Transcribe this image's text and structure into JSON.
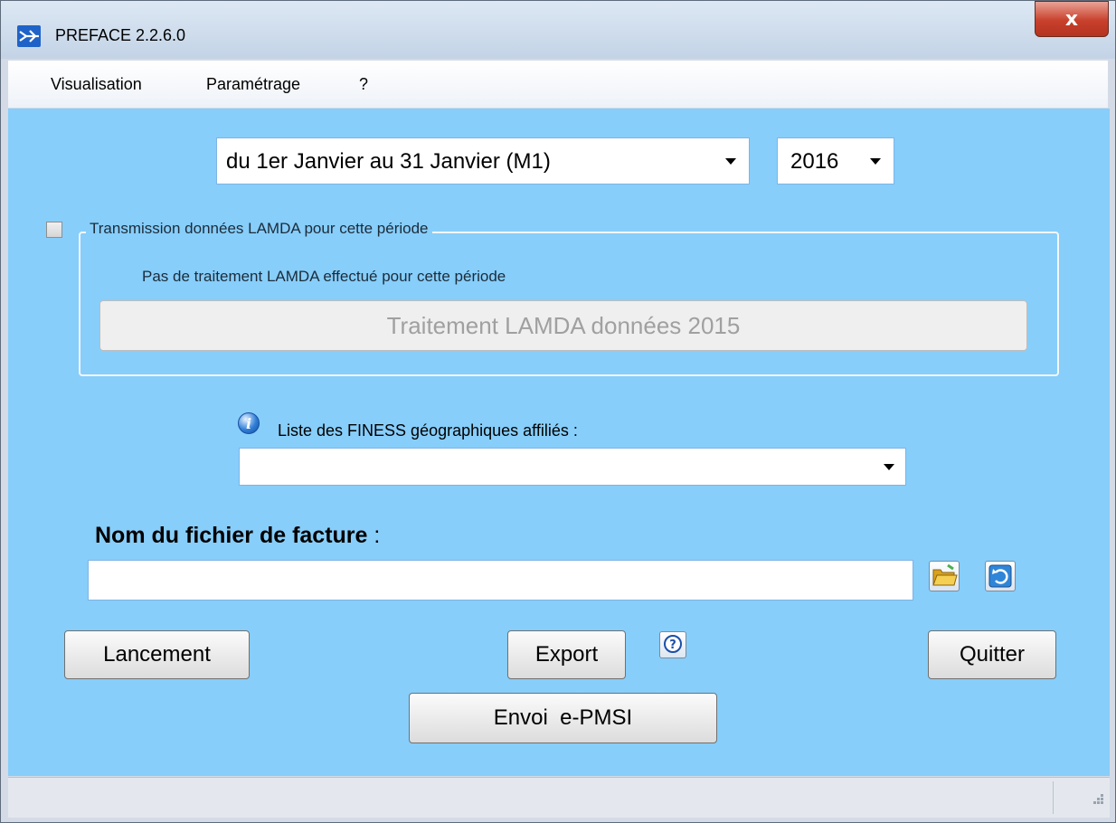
{
  "window": {
    "title": "PREFACE 2.2.6.0",
    "close_label": "x"
  },
  "menu": {
    "items": [
      "Visualisation",
      "Paramétrage",
      "?"
    ]
  },
  "period": {
    "selected": "du 1er Janvier au 31 Janvier (M1)"
  },
  "year": {
    "selected": "2016"
  },
  "lamda": {
    "checked": false,
    "group_label": "Transmission données LAMDA  pour cette période",
    "info_text": "Pas de traitement LAMDA effectué pour cette période",
    "button_label": "Traitement LAMDA données 2015",
    "button_enabled": false
  },
  "finess": {
    "label": "Liste des FINESS géographiques affiliés :",
    "selected": ""
  },
  "facture": {
    "label": "Nom du fichier de facture",
    "colon": " :",
    "value": ""
  },
  "buttons": {
    "lancement": "Lancement",
    "export": "Export",
    "quitter": "Quitter",
    "envoi": "Envoi  e-PMSI"
  },
  "icons": {
    "app": "preface-app-icon",
    "info": "info-icon",
    "folder": "folder-open-icon",
    "refresh": "refresh-icon",
    "help": "help-question-icon"
  },
  "colors": {
    "client_bg": "#87cefa",
    "close_button": "#c8402c"
  }
}
